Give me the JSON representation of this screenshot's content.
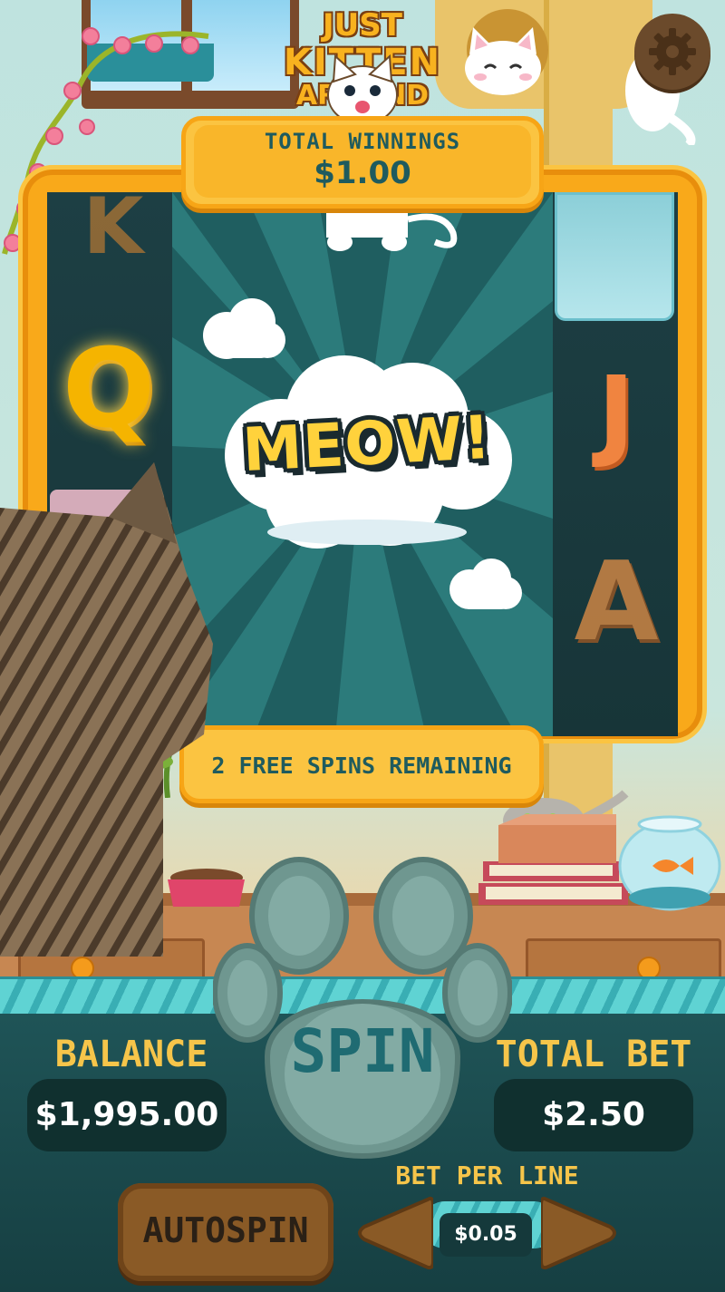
{
  "game": {
    "logo": {
      "line1": "JUST",
      "line2": "KITTEN",
      "line3": "AROUND"
    }
  },
  "total_winnings": {
    "label": "TOTAL WINNINGS",
    "value": "$1.00"
  },
  "banner": {
    "text": "MEOW!"
  },
  "free_spins": {
    "label": "2 FREE SPINS REMAINING"
  },
  "reels": {
    "symbols": [
      "K",
      "Q",
      "J",
      "A"
    ]
  },
  "balance": {
    "label": "BALANCE",
    "value": "$1,995.00"
  },
  "total_bet": {
    "label": "TOTAL BET",
    "value": "$2.50"
  },
  "spin": {
    "label": "SPIN"
  },
  "autospin": {
    "label": "AUTOSPIN"
  },
  "bet_per_line": {
    "label": "BET PER LINE",
    "value": "$0.05"
  },
  "icons": {
    "settings": "gear-icon",
    "decrease": "arrow-left-icon",
    "increase": "arrow-right-icon",
    "spin": "paw-icon"
  },
  "colors": {
    "accent_gold": "#fbc441",
    "text_teal": "#1f5b5e",
    "label_yellow": "#f6c54a",
    "panel_dark": "#10302f"
  }
}
